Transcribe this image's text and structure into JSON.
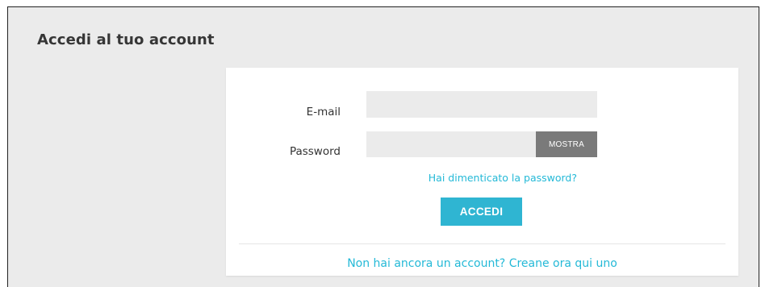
{
  "page": {
    "title": "Accedi al tuo account"
  },
  "form": {
    "email_label": "E-mail",
    "email_value": "",
    "password_label": "Password",
    "password_value": "",
    "show_button_label": "MOSTRA",
    "forgot_password_link": "Hai dimenticato la password?",
    "submit_label": "ACCEDI"
  },
  "footer": {
    "register_link": "Non hai ancora un account? Creane ora qui uno"
  },
  "colors": {
    "accent": "#2fb5d2",
    "link": "#24b9d7",
    "page_background": "#ebebeb",
    "show_button": "#7a7a7a"
  }
}
